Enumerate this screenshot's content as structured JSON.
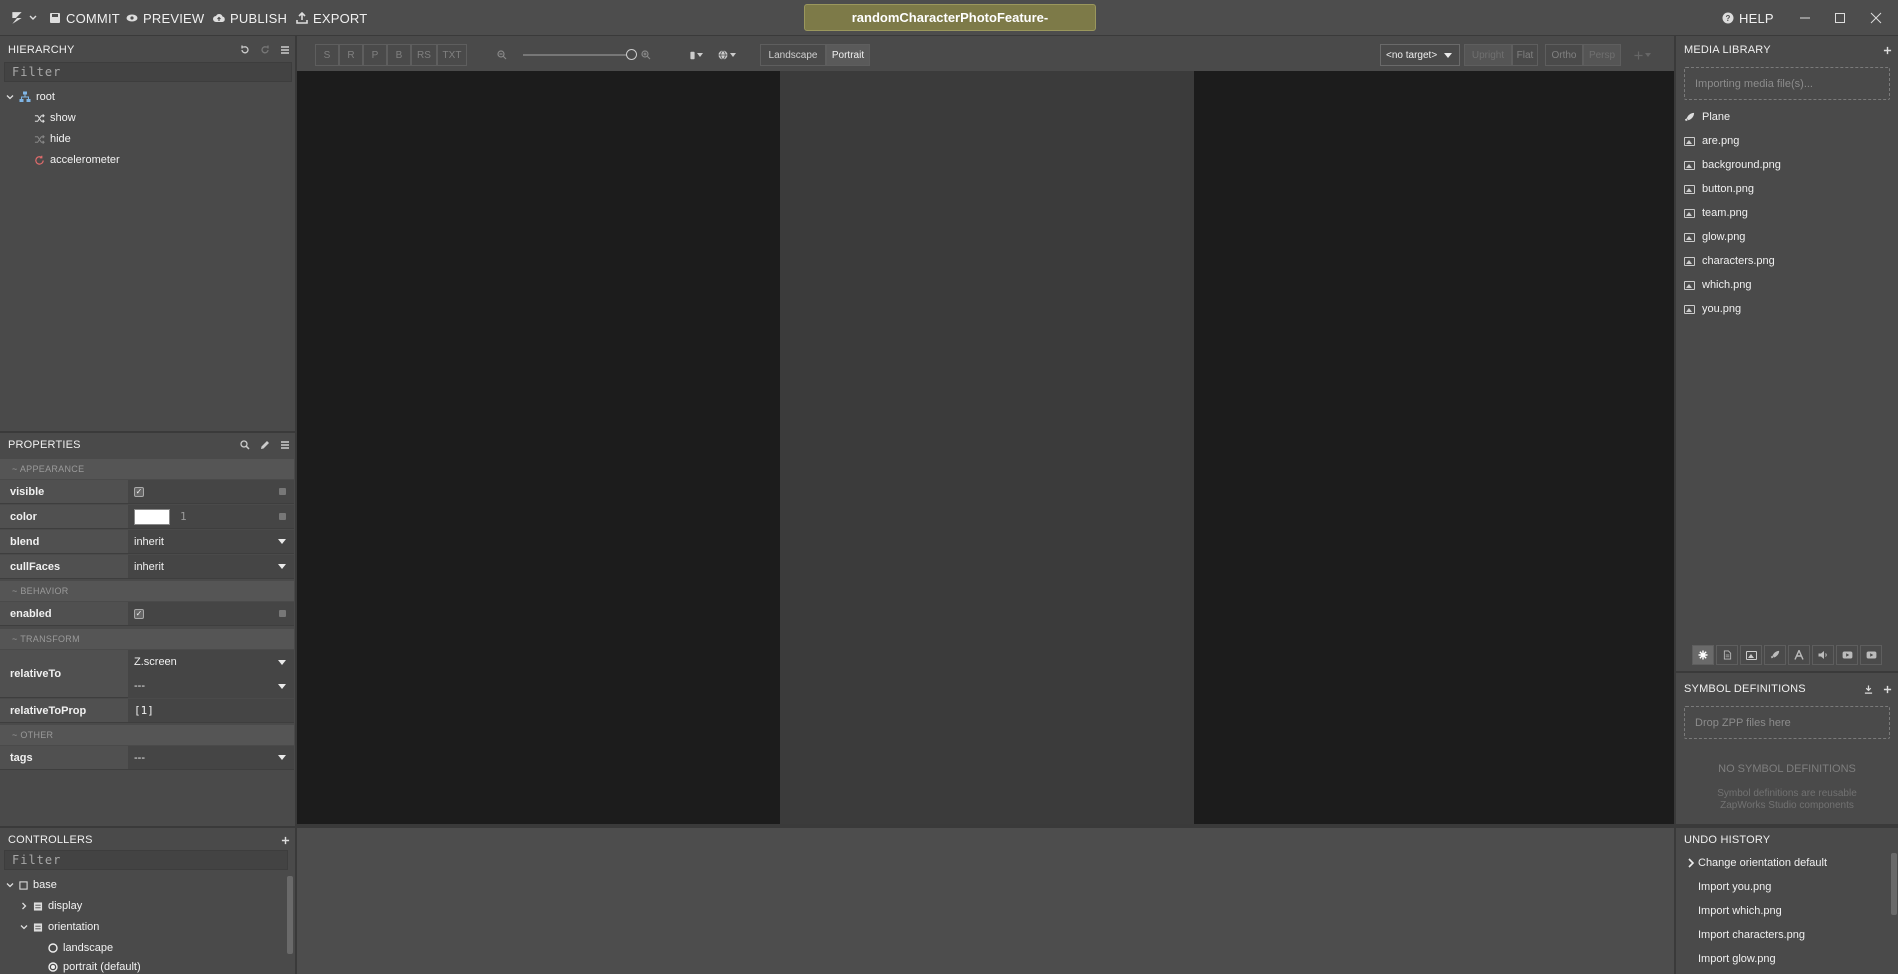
{
  "topbar": {
    "commit": "COMMIT",
    "preview": "PREVIEW",
    "publish": "PUBLISH",
    "export": "EXPORT",
    "project_title": "randomCharacterPhotoFeature-",
    "help": "HELP"
  },
  "hierarchy": {
    "title": "HIERARCHY",
    "filter_placeholder": "Filter",
    "items": [
      {
        "label": "root",
        "icon": "hierarchy-icon"
      },
      {
        "label": "show",
        "icon": "shuffle-icon"
      },
      {
        "label": "hide",
        "icon": "shuffle-icon"
      },
      {
        "label": "accelerometer",
        "icon": "refresh-icon"
      }
    ]
  },
  "properties": {
    "title": "PROPERTIES",
    "sections": {
      "appearance": "~ APPEARANCE",
      "behavior": "~ BEHAVIOR",
      "transform": "~ TRANSFORM",
      "other": "~ OTHER"
    },
    "rows": {
      "visible": {
        "name": "visible",
        "checked": true
      },
      "color": {
        "name": "color",
        "swatch": "#ffffff",
        "alpha": "1"
      },
      "blend": {
        "name": "blend",
        "value": "inherit"
      },
      "cullFaces": {
        "name": "cullFaces",
        "value": "inherit"
      },
      "enabled": {
        "name": "enabled",
        "checked": true
      },
      "relativeTo": {
        "name": "relativeTo",
        "value1": "Z.screen",
        "value2": "---"
      },
      "relativeToProp": {
        "name": "relativeToProp",
        "value": "[1]"
      },
      "tags": {
        "name": "tags",
        "value": "---"
      }
    }
  },
  "controllers": {
    "title": "CONTROLLERS",
    "filter_placeholder": "Filter",
    "items": [
      {
        "label": "base"
      },
      {
        "label": "display"
      },
      {
        "label": "orientation"
      },
      {
        "label": "landscape"
      },
      {
        "label": "portrait (default)"
      }
    ]
  },
  "viewport": {
    "mode_buttons": [
      "S",
      "R",
      "P",
      "B",
      "RS",
      "TXT"
    ],
    "orientation": {
      "landscape": "Landscape",
      "portrait": "Portrait",
      "selected": "Portrait"
    },
    "target": "<no target>",
    "view_buttons": [
      "Upright",
      "Flat"
    ],
    "projection_buttons": [
      "Ortho",
      "Persp"
    ],
    "zoom_level": 1.0
  },
  "media_library": {
    "title": "MEDIA LIBRARY",
    "importing": "Importing media file(s)...",
    "items": [
      {
        "label": "Plane",
        "icon": "rocket-icon"
      },
      {
        "label": "are.png",
        "icon": "image-icon"
      },
      {
        "label": "background.png",
        "icon": "image-icon"
      },
      {
        "label": "button.png",
        "icon": "image-icon"
      },
      {
        "label": "team.png",
        "icon": "image-icon"
      },
      {
        "label": "glow.png",
        "icon": "image-icon"
      },
      {
        "label": "characters.png",
        "icon": "image-icon"
      },
      {
        "label": "which.png",
        "icon": "image-icon"
      },
      {
        "label": "you.png",
        "icon": "image-icon"
      }
    ],
    "filters": [
      "all-icon",
      "document-icon",
      "image-icon",
      "rocket-icon",
      "font-icon",
      "audio-icon",
      "video-icon",
      "video-alt-icon"
    ]
  },
  "symbol_definitions": {
    "title": "SYMBOL DEFINITIONS",
    "drop_hint": "Drop ZPP files here",
    "empty_title": "NO SYMBOL DEFINITIONS",
    "empty_desc_1": "Symbol definitions are reusable",
    "empty_desc_2": "ZapWorks Studio components"
  },
  "undo_history": {
    "title": "UNDO HISTORY",
    "items": [
      {
        "label": "Change orientation default",
        "current": true
      },
      {
        "label": "Import you.png"
      },
      {
        "label": "Import which.png"
      },
      {
        "label": "Import characters.png"
      },
      {
        "label": "Import glow.png"
      }
    ]
  },
  "colors": {
    "accent_title": "#7d7a48",
    "background": "#4a4a4a",
    "viewport": "#1c1c1c"
  }
}
